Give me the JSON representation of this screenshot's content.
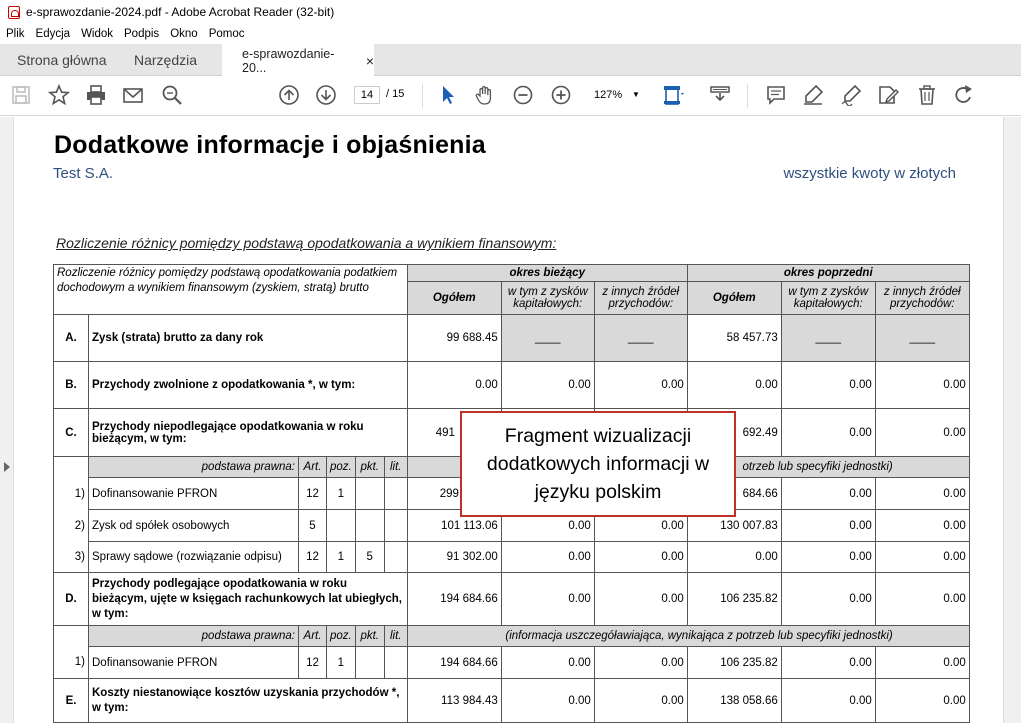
{
  "window": {
    "title": "e-sprawozdanie-2024.pdf - Adobe Acrobat Reader (32-bit)"
  },
  "menu": [
    "Plik",
    "Edycja",
    "Widok",
    "Podpis",
    "Okno",
    "Pomoc"
  ],
  "tabs": {
    "home": "Strona główna",
    "tools": "Narzędzia",
    "doc": "e-sprawozdanie-20...",
    "close": "×"
  },
  "toolbar": {
    "page_current": "14",
    "page_sep": "/",
    "page_total": "15",
    "zoom": "127%"
  },
  "doc": {
    "title": "Dodatkowe informacje i objaśnienia",
    "company": "Test S.A.",
    "amounts_note": "wszystkie kwoty w złotych",
    "section_title": "Rozliczenie różnicy pomiędzy podstawą opodatkowania a wynikiem finansowym:",
    "table": {
      "corner": "Rozliczenie różnicy pomiędzy podstawą opodatkowania podatkiem dochodowym a wynikiem finansowym (zyskiem, stratą) brutto",
      "current": "okres bieżący",
      "previous": "okres poprzedni",
      "col_total": "Ogółem",
      "col_capital": "w tym z zysków kapitałowych:",
      "col_other": "z innych źródeł przychodów:",
      "legal_basis": "podstawa prawna:",
      "art": "Art.",
      "poz": "poz.",
      "pkt": "pkt.",
      "lit": "lit.",
      "info_note": "(informacja uszczegóławiająca, wynikająca z potrzeb lub specyfiki jednostki)",
      "info_note_partial": "otrzeb lub specyfiki jednostki)",
      "dash": "____",
      "zero": "0.00",
      "rows": {
        "A": {
          "mark": "A.",
          "label": "Zysk (strata) brutto za dany rok",
          "cur": "99 688.45",
          "prev": "58 457.73"
        },
        "B": {
          "mark": "B.",
          "label": "Przychody zwolnione z opodatkowania *, w tym:"
        },
        "C": {
          "mark": "C.",
          "label": "Przychody niepodlegające opodatkowania w roku bieżącym, w tym:",
          "cur": "491",
          "prev": "692.49"
        },
        "C1": {
          "mark": "1)",
          "label": "Dofinansowanie PFRON",
          "art": "12",
          "poz": "1",
          "cur": "299",
          "prev": "684.66"
        },
        "C2": {
          "mark": "2)",
          "label": "Zysk od spółek osobowych",
          "art": "5",
          "cur": "101 113.06",
          "prev": "130 007.83"
        },
        "C3": {
          "mark": "3)",
          "label": "Sprawy sądowe (rozwiązanie odpisu)",
          "art": "12",
          "poz": "1",
          "pkt": "5",
          "cur": "91 302.00"
        },
        "D": {
          "mark": "D.",
          "label": "Przychody podlegające opodatkowania w roku bieżącym, ujęte w księgach rachunkowych lat ubiegłych, w tym:",
          "cur": "194 684.66",
          "prev": "106 235.82"
        },
        "D1": {
          "mark": "1)",
          "label": "Dofinansowanie PFRON",
          "art": "12",
          "poz": "1",
          "cur": "194 684.66",
          "prev": "106 235.82"
        },
        "E": {
          "mark": "E.",
          "label": "Koszty niestanowiące kosztów uzyskania przychodów *, w tym:",
          "cur": "113 984.43",
          "prev": "138 058.66"
        }
      }
    }
  },
  "overlay": {
    "text": "Fragment wizualizacji dodatkowych informacji w języku polskim"
  }
}
